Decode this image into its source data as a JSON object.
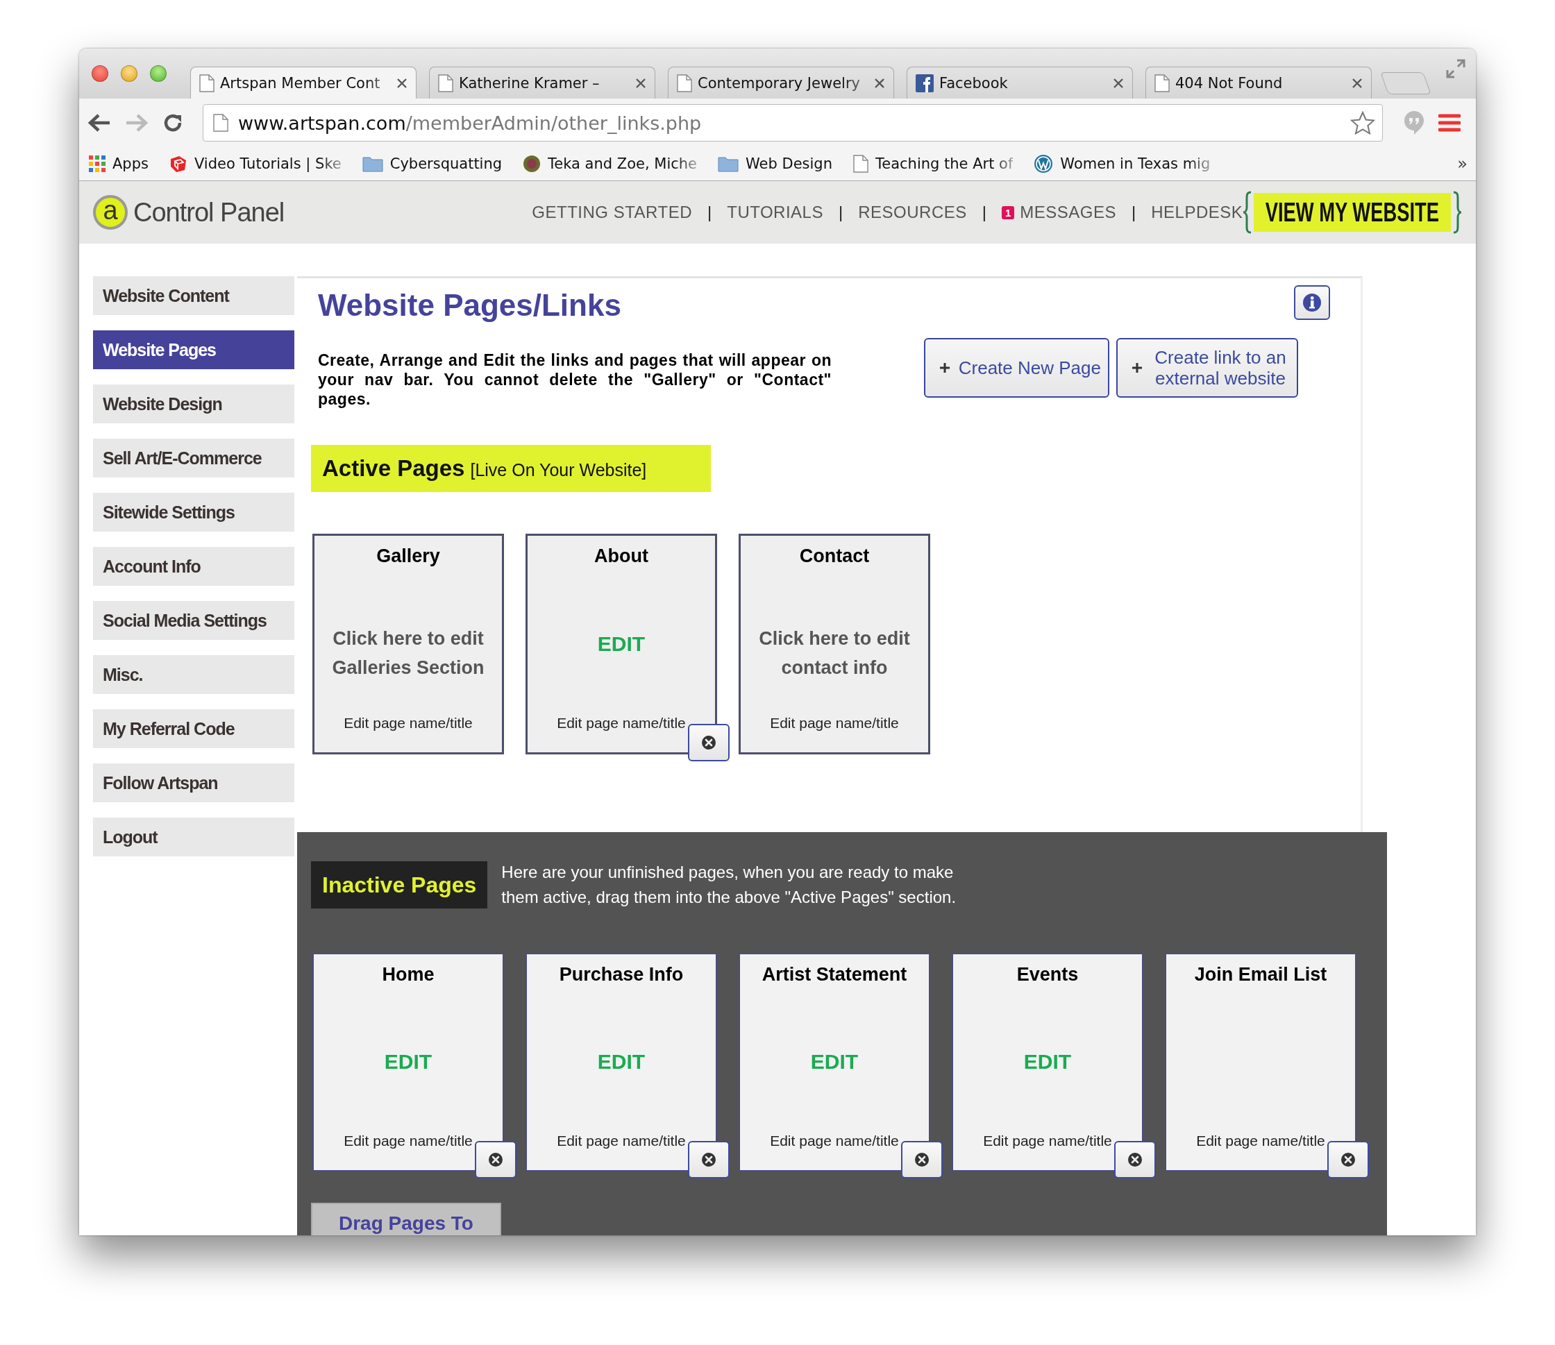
{
  "browser": {
    "tabs": [
      {
        "title": "Artspan Member Cont",
        "kind": "page",
        "selected": true
      },
      {
        "title": "Katherine Kramer –",
        "kind": "page",
        "selected": false
      },
      {
        "title": "Contemporary Jewelry",
        "kind": "page",
        "selected": false
      },
      {
        "title": "Facebook",
        "kind": "facebook",
        "selected": false
      },
      {
        "title": "404 Not Found",
        "kind": "page",
        "selected": false
      }
    ],
    "address": {
      "host": "www.artspan.com",
      "path": "/memberAdmin/other_links.php"
    },
    "bookmarks": [
      {
        "label": "Apps",
        "kind": "apps"
      },
      {
        "label": "Video Tutorials | Ske",
        "kind": "sketch"
      },
      {
        "label": "Cybersquatting",
        "kind": "folder"
      },
      {
        "label": "Teka and Zoe, Miche",
        "kind": "avatar"
      },
      {
        "label": "Web Design",
        "kind": "folder"
      },
      {
        "label": "Teaching the Art of",
        "kind": "page"
      },
      {
        "label": "Women in Texas mig",
        "kind": "wordpress"
      }
    ],
    "bookmarks_more": "»"
  },
  "header": {
    "logo_letter": "a",
    "title": "Control Panel",
    "nav": [
      {
        "kind": "link",
        "label": "GETTING STARTED"
      },
      {
        "kind": "separator",
        "label": "|"
      },
      {
        "kind": "link",
        "label": "TUTORIALS"
      },
      {
        "kind": "separator",
        "label": "|"
      },
      {
        "kind": "link",
        "label": "RESOURCES"
      },
      {
        "kind": "separator",
        "label": "|"
      },
      {
        "kind": "link",
        "label": "MESSAGES",
        "badge": "1"
      },
      {
        "kind": "separator",
        "label": "|"
      },
      {
        "kind": "link",
        "label": "HELPDESK"
      }
    ],
    "cta": "VIEW MY WEBSITE"
  },
  "sidebar": {
    "items": [
      {
        "label": "Website Content",
        "selected": false
      },
      {
        "label": "Website Pages",
        "selected": true
      },
      {
        "label": "Website Design",
        "selected": false
      },
      {
        "label": "Sell Art/E-Commerce",
        "selected": false
      },
      {
        "label": "Sitewide Settings",
        "selected": false
      },
      {
        "label": "Account Info",
        "selected": false
      },
      {
        "label": "Social Media Settings",
        "selected": false
      },
      {
        "label": "Misc.",
        "selected": false
      },
      {
        "label": "My Referral Code",
        "selected": false
      },
      {
        "label": "Follow Artspan",
        "selected": false
      },
      {
        "label": "Logout",
        "selected": false
      }
    ]
  },
  "main": {
    "title": "Website Pages/Links",
    "description": "Create, Arrange and Edit the links and pages that will appear on your nav bar. You cannot delete the \"Gallery\" or \"Contact\" pages.",
    "buttons": [
      {
        "label": "Create New Page"
      },
      {
        "label": "Create link to an external website"
      }
    ],
    "active": {
      "heading": "Active Pages",
      "note": "[Live On Your Website]",
      "cards": [
        {
          "title": "Gallery",
          "kind": "note",
          "action": "Click here to edit Galleries Section",
          "link": "Edit page name/title",
          "removable": false
        },
        {
          "title": "About",
          "kind": "edit",
          "action": "EDIT",
          "link": "Edit page name/title",
          "removable": true
        },
        {
          "title": "Contact",
          "kind": "note",
          "action": "Click here to edit contact info",
          "link": "Edit page name/title",
          "removable": false
        }
      ]
    },
    "inactive": {
      "heading": "Inactive Pages",
      "note": "Here are your unfinished pages, when you are ready to make them active, drag them into the above \"Active Pages\" section.",
      "cards": [
        {
          "title": "Home",
          "kind": "edit",
          "action": "EDIT",
          "link": "Edit page name/title",
          "removable": true
        },
        {
          "title": "Purchase Info",
          "kind": "edit",
          "action": "EDIT",
          "link": "Edit page name/title",
          "removable": true
        },
        {
          "title": "Artist Statement",
          "kind": "edit",
          "action": "EDIT",
          "link": "Edit page name/title",
          "removable": true
        },
        {
          "title": "Events",
          "kind": "edit",
          "action": "EDIT",
          "link": "Edit page name/title",
          "removable": true
        },
        {
          "title": "Join Email List",
          "kind": "plain",
          "link": "Edit page name/title",
          "removable": true
        }
      ],
      "drop_target": "Drag Pages To"
    }
  }
}
